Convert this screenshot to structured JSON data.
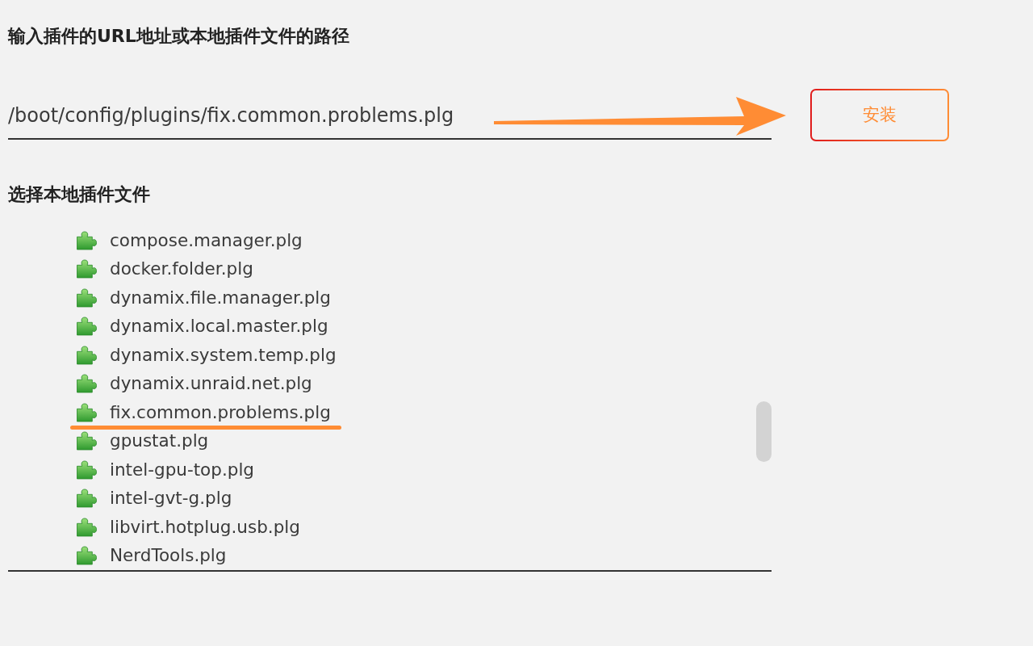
{
  "install": {
    "heading": "输入插件的URL地址或本地插件文件的路径",
    "path_field": {
      "value": "/boot/config/plugins/fix.common.problems.plg"
    },
    "install_button": {
      "label": "安装"
    }
  },
  "local_files": {
    "heading": "选择本地插件文件",
    "files": [
      {
        "name": "compose.manager.plg",
        "highlighted": false
      },
      {
        "name": "docker.folder.plg",
        "highlighted": false
      },
      {
        "name": "dynamix.file.manager.plg",
        "highlighted": false
      },
      {
        "name": "dynamix.local.master.plg",
        "highlighted": false
      },
      {
        "name": "dynamix.system.temp.plg",
        "highlighted": false
      },
      {
        "name": "dynamix.unraid.net.plg",
        "highlighted": false
      },
      {
        "name": "fix.common.problems.plg",
        "highlighted": true
      },
      {
        "name": "gpustat.plg",
        "highlighted": false
      },
      {
        "name": "intel-gpu-top.plg",
        "highlighted": false
      },
      {
        "name": "intel-gvt-g.plg",
        "highlighted": false
      },
      {
        "name": "libvirt.hotplug.usb.plg",
        "highlighted": false
      },
      {
        "name": "NerdTools.plg",
        "highlighted": false
      }
    ]
  }
}
